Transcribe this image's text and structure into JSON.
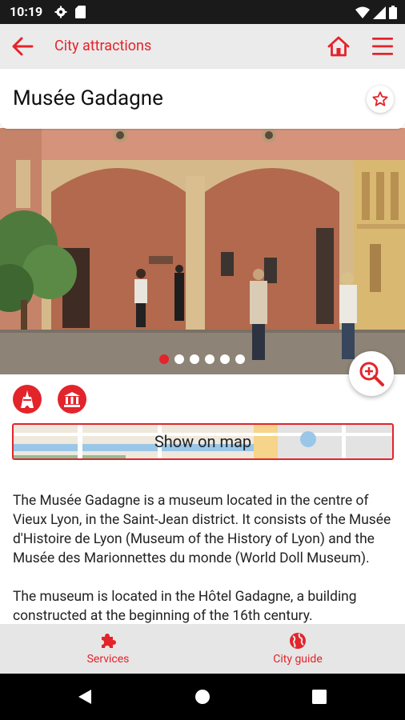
{
  "status_bar": {
    "time": "10:19"
  },
  "app_bar": {
    "title": "City attractions"
  },
  "poi": {
    "name": "Musée Gadagne"
  },
  "gallery": {
    "total_images": 6,
    "active_index": 0
  },
  "map_button": {
    "label": "Show on map"
  },
  "description": {
    "paragraphs": [
      "The Musée Gadagne is a museum located in the centre of Vieux Lyon, in the Saint-Jean district. It consists of the Musée d'Histoire de Lyon (Museum of the History of Lyon) and the Musée des Marionnettes du monde (World Doll Museum).",
      "The museum is located in the Hôtel Gadagne, a building constructed at the beginning of the 16th century."
    ]
  },
  "bottom_nav": {
    "items": [
      {
        "label": "Services",
        "icon": "puzzle-icon"
      },
      {
        "label": "City guide",
        "icon": "globe-icon"
      }
    ]
  },
  "colors": {
    "accent": "#e3242b",
    "app_bar_bg": "#ebebeb",
    "bottom_nav_bg": "#e6e6e6"
  }
}
